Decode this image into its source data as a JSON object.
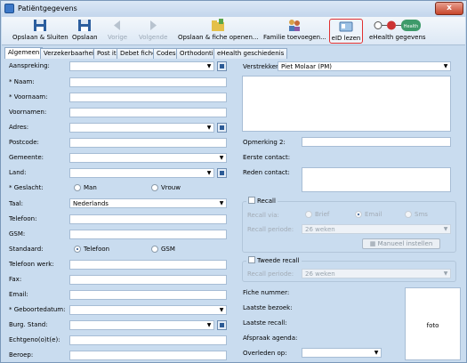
{
  "window": {
    "title": "Patiëntgegevens",
    "close": "x"
  },
  "toolbar": {
    "save_close": "Opslaan & Sluiten",
    "save": "Opslaan",
    "prev": "Vorige",
    "next": "Volgende",
    "save_open": "Opslaan & fiche openen...",
    "family_add": "Familie toevoegen...",
    "eid": "eID lezen",
    "ehealth": "eHealth gegevens",
    "health_badge": "Health"
  },
  "tabs": [
    "Algemeen",
    "Verzekerbaarheid",
    "Post it",
    "Debet fiche",
    "Codes",
    "Orthodontie",
    "eHealth geschiedenis"
  ],
  "labels": {
    "aanspreking": "Aanspreking:",
    "naam": "* Naam:",
    "voornaam": "* Voornaam:",
    "voornamen": "Voornamen:",
    "adres": "Adres:",
    "postcode": "Postcode:",
    "gemeente": "Gemeente:",
    "land": "Land:",
    "geslacht": "* Geslacht:",
    "taal": "Taal:",
    "telefoon": "Telefoon:",
    "gsm": "GSM:",
    "standaard": "Standaard:",
    "telefoon_werk": "Telefoon werk:",
    "fax": "Fax:",
    "email": "Email:",
    "geboortedatum": "* Geboortedatum:",
    "burg_stand": "Burg. Stand:",
    "echtgenote": "Echtgeno(o)t(e):",
    "beroep": "Beroep:",
    "verstrekker": "Verstrekker:",
    "opmerking2": "Opmerking 2:",
    "eerste_contact": "Eerste contact:",
    "reden_contact": "Reden contact:",
    "fiche_nummer": "Fiche nummer:",
    "laatste_bezoek": "Laatste bezoek:",
    "laatste_recall": "Laatste recall:",
    "afspraak_agenda": "Afspraak agenda:",
    "overleden_op": "Overleden op:"
  },
  "values": {
    "taal": "Nederlands",
    "verstrekker": "Piet Molaar (PM)"
  },
  "gender": {
    "man": "Man",
    "vrouw": "Vrouw"
  },
  "standaard": {
    "telefoon": "Telefoon",
    "gsm": "GSM"
  },
  "recall": {
    "title": "Recall",
    "via": "Recall via:",
    "brief": "Brief",
    "email": "Email",
    "sms": "Sms",
    "periode": "Recall periode:",
    "periode_value": "26 weken",
    "manueel": "Manueel instellen"
  },
  "tweede_recall": {
    "title": "Tweede recall",
    "periode": "Recall periode:",
    "periode_value": "26 weken"
  },
  "photo_label": "foto"
}
